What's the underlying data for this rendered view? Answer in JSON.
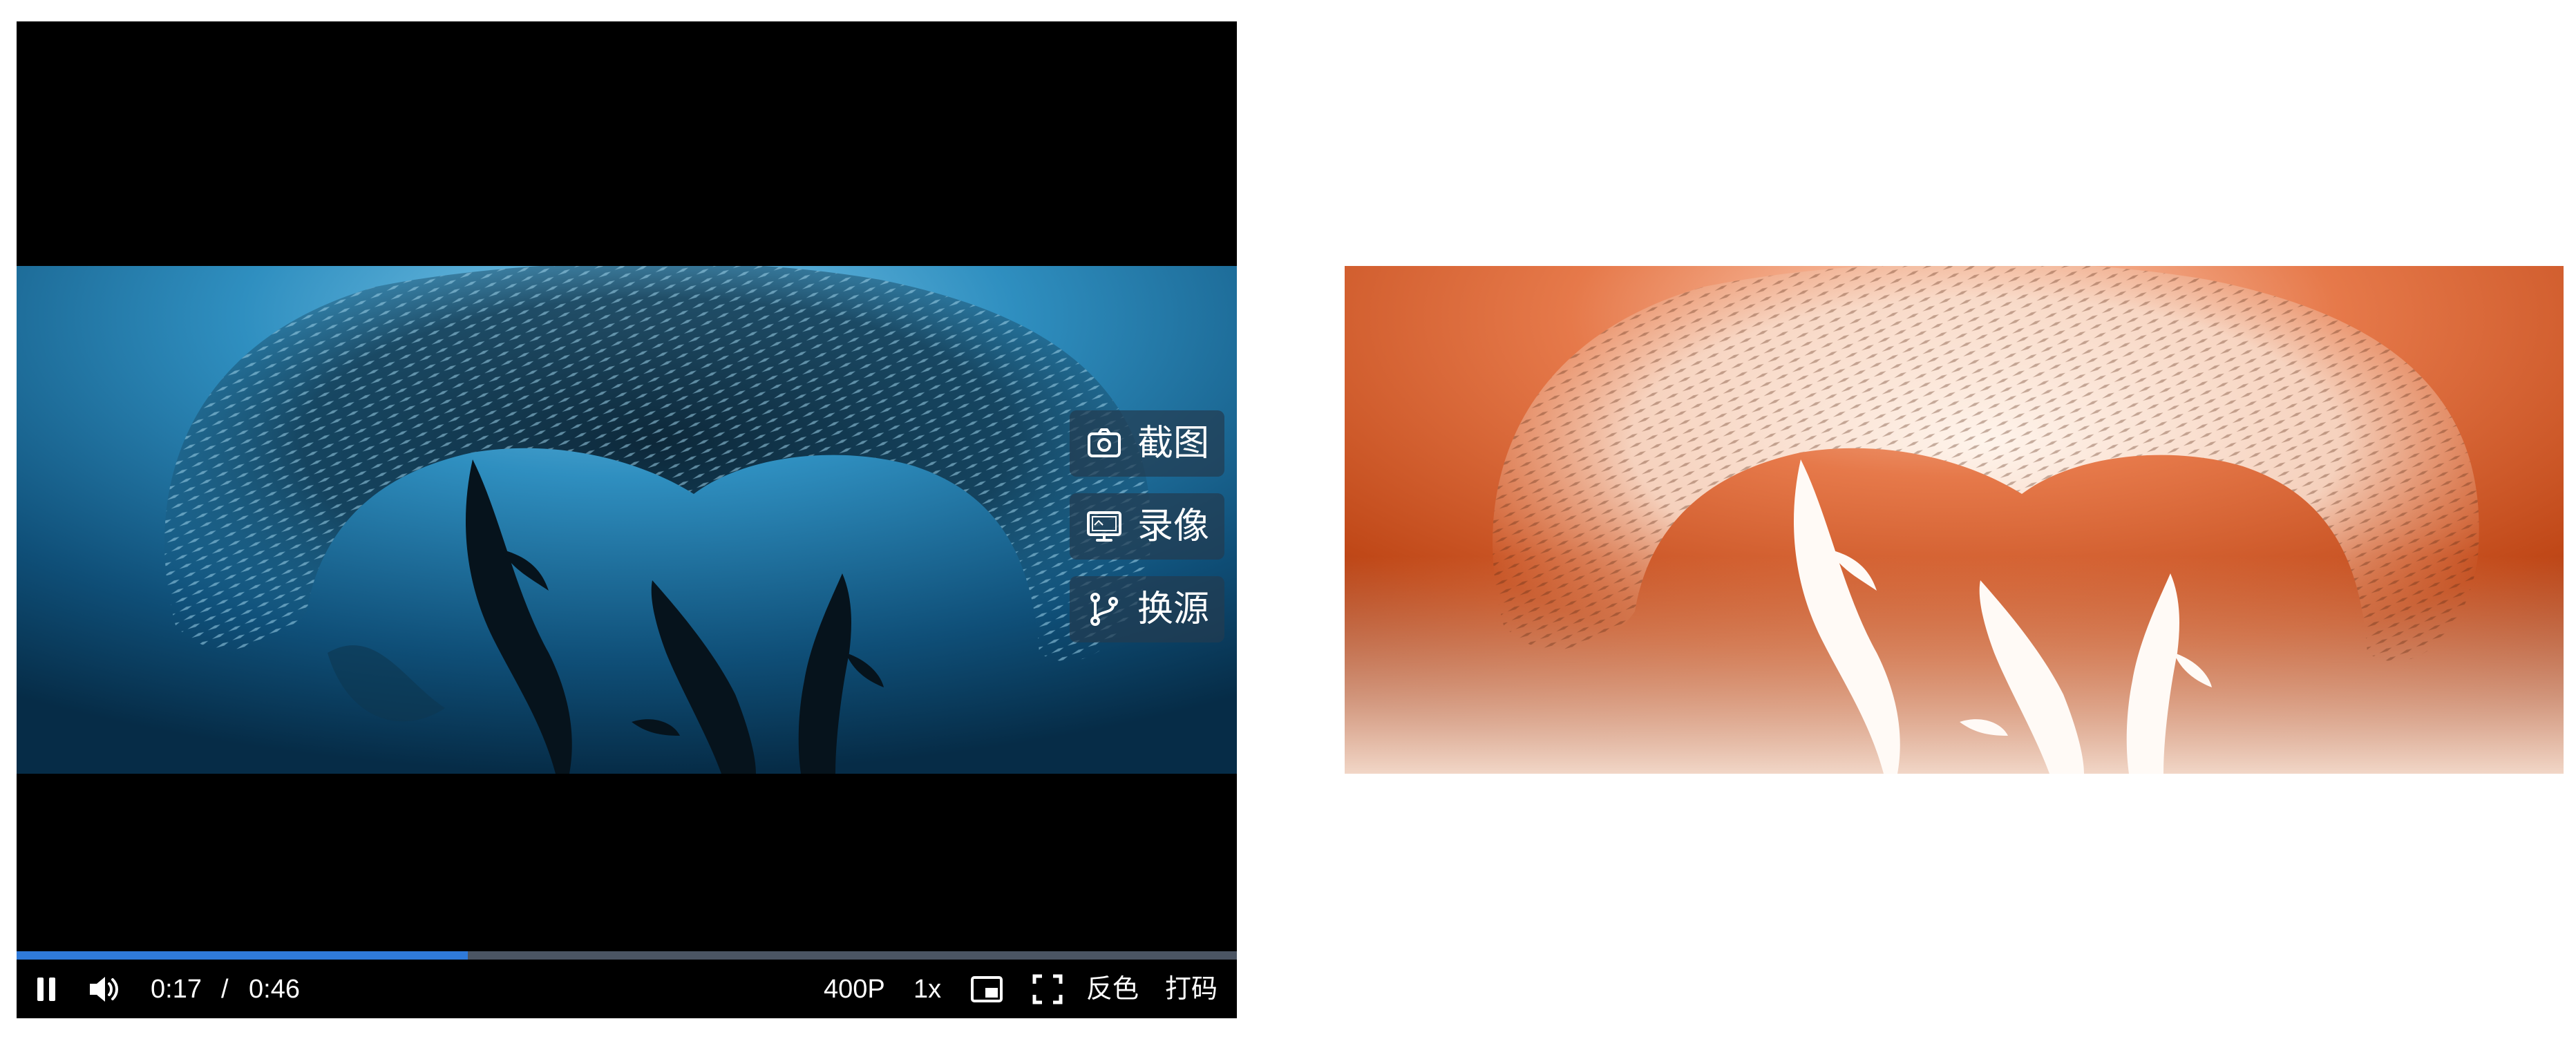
{
  "player": {
    "side_buttons": [
      {
        "label": "截图",
        "icon": "camera-icon"
      },
      {
        "label": "录像",
        "icon": "screen-record-icon"
      },
      {
        "label": "换源",
        "icon": "branch-switch-icon"
      }
    ],
    "controls": {
      "play_state_icon": "pause-icon",
      "volume_icon": "volume-icon",
      "current_time": "0:17",
      "time_separator": "/",
      "duration": "0:46",
      "quality": "400P",
      "speed": "1x",
      "pip_icon": "picture-in-picture-icon",
      "fullscreen_icon": "fullscreen-icon",
      "invert_label": "反色",
      "mosaic_label": "打码"
    },
    "progress_fraction": 0.3696
  },
  "colors": {
    "accent": "#2f7ad9",
    "progress_track": "#4b5563",
    "player_bg": "#000000",
    "page_bg": "#ffffff"
  }
}
